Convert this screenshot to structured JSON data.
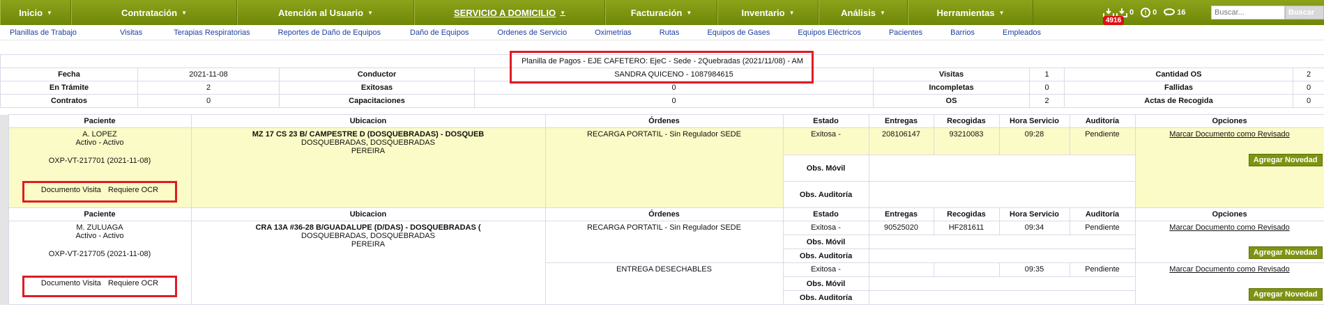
{
  "topnav": {
    "items": [
      {
        "label": "Inicio",
        "width": 102
      },
      {
        "label": "Contratación",
        "width": 238
      },
      {
        "label": "Atención al Usuario",
        "width": 254
      },
      {
        "label": "SERVICIO A DOMICILIO",
        "width": 274
      },
      {
        "label": "Facturación",
        "width": 161
      },
      {
        "label": "Inventario",
        "width": 145
      },
      {
        "label": "Análisis",
        "width": 128
      },
      {
        "label": "Herramientas",
        "width": 180
      }
    ],
    "active_label": "SERVICIO A DOMICILIO",
    "notifications": {
      "badge_count": "4916",
      "count_alert": "0",
      "count_info": "0",
      "count_chat": "16"
    },
    "search_placeholder": "Buscar...",
    "search_button": "Buscar"
  },
  "subnav": [
    "Planillas de Trabajo",
    "Visitas",
    "Terapias Respiratorias",
    "Reportes de Daño de Equipos",
    "Daño de Equipos",
    "Ordenes de Servicio",
    "Oximetrias",
    "Rutas",
    "Equipos de Gases",
    "Equipos Eléctricos",
    "Pacientes",
    "Barrios",
    "Empleados"
  ],
  "summary": {
    "title": "Planilla de Pagos - EJE CAFETERO: EjeC - Sede - 2Quebradas (2021/11/08) - AM",
    "fecha_label": "Fecha",
    "fecha_value": "2021-11-08",
    "conductor_label": "Conductor",
    "conductor_value": "SANDRA QUICENO - 1087984615",
    "visitas_label": "Visitas",
    "visitas_value": "1",
    "cantidad_os_label": "Cantidad OS",
    "cantidad_os_value": "2",
    "tramite_label": "En Trámite",
    "tramite_value": "2",
    "exitosas_label": "Exitosas",
    "exitosas_value": "0",
    "incompletas_label": "Incompletas",
    "incompletas_value": "0",
    "fallidas_label": "Fallidas",
    "fallidas_value": "0",
    "contratos_label": "Contratos",
    "contratos_value": "0",
    "capacitaciones_label": "Capacitaciones",
    "capacitaciones_value": "0",
    "os_label": "OS",
    "os_value": "2",
    "actas_label": "Actas de Recogida",
    "actas_value": "0"
  },
  "detail": {
    "headers": [
      "Paciente",
      "Ubicacion",
      "Órdenes",
      "Estado",
      "Entregas",
      "Recogidas",
      "Hora Servicio",
      "Auditoría",
      "Opciones"
    ],
    "obs_movil": "Obs. Móvil",
    "obs_auditoria": "Obs. Auditoría",
    "mark_reviewed": "Marcar Documento como Revisado",
    "add_novedad": "Agregar Novedad",
    "doc_visita": "Documento Visita",
    "requiere_ocr": "Requiere OCR",
    "rows": [
      {
        "patient_name": "A. LOPEZ",
        "patient_status": "Activo - Activo",
        "patient_code": "OXP-VT-217701 (2021-11-08)",
        "address": "MZ 17 CS 23 B/ CAMPESTRE D (DOSQUEBRADAS) - DOSQUEB",
        "city1": "DOSQUEBRADAS, DOSQUEBRADAS",
        "city2": "PEREIRA",
        "orders": [
          {
            "order": "RECARGA PORTATIL - Sin Regulador SEDE",
            "estado": "Exitosa -",
            "entregas": "208106147",
            "recogidas": "93210083",
            "hora": "09:28",
            "auditoria": "Pendiente"
          }
        ]
      },
      {
        "patient_name": "M. ZULUAGA",
        "patient_status": "Activo - Activo",
        "patient_code": "OXP-VT-217705 (2021-11-08)",
        "address": "CRA 13A #36-28 B/GUADALUPE (D/DAS) - DOSQUEBRADAS (",
        "city1": "DOSQUEBRADAS, DOSQUEBRADAS",
        "city2": "PEREIRA",
        "orders": [
          {
            "order": "RECARGA PORTATIL - Sin Regulador SEDE",
            "estado": "Exitosa -",
            "entregas": "90525020",
            "recogidas": "HF281611",
            "hora": "09:34",
            "auditoria": "Pendiente"
          },
          {
            "order": "ENTREGA DESECHABLES",
            "estado": "Exitosa -",
            "entregas": "",
            "recogidas": "",
            "hora": "09:35",
            "auditoria": "Pendiente"
          }
        ]
      }
    ]
  },
  "colors": {
    "nav_green": "#7a9210",
    "highlight_red": "#e01b24",
    "row_yellow": "#fbfbc7",
    "link_blue": "#1a3fa0"
  }
}
